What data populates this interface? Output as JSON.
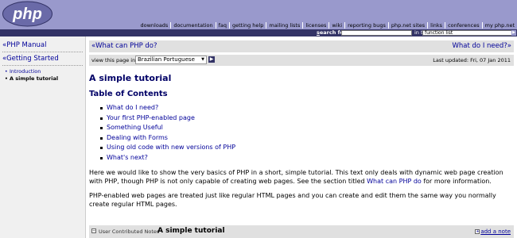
{
  "header": {
    "logo_text": "php",
    "nav": [
      "downloads",
      "documentation",
      "faq",
      "getting help",
      "mailing lists",
      "licenses",
      "wiki",
      "reporting bugs",
      "php.net sites",
      "links",
      "conferences",
      "my php.net"
    ],
    "search_label_underlined": "s",
    "search_label_rest": "earch for",
    "search_in": "in the",
    "search_scope": "function list"
  },
  "sidebar": {
    "manual_link": "PHP Manual",
    "section_title": "Getting Started",
    "items": [
      {
        "label": "Introduction",
        "active": false
      },
      {
        "label": "A simple tutorial",
        "active": true
      }
    ]
  },
  "main": {
    "prev_label": "What can PHP do?",
    "next_label": "What do I need?",
    "lang_label": "view this page in",
    "lang_value": "Brazilian Portuguese",
    "last_updated": "Last updated: Fri, 07 Jan 2011",
    "title": "A simple tutorial",
    "toc_title": "Table of Contents",
    "toc": [
      "What do I need?",
      "Your first PHP-enabled page",
      "Something Useful",
      "Dealing with Forms",
      "Using old code with new versions of PHP",
      "What's next?"
    ],
    "para1_a": "Here we would like to show the very basics of PHP in a short, simple tutorial. This text only deals with dynamic web page creation with PHP, though PHP is not only capable of creating web pages. See the section titled ",
    "para1_link": "What can PHP do",
    "para1_b": " for more information.",
    "para2": "PHP-enabled web pages are treated just like regular HTML pages and you can create and edit them the same way you normally create regular HTML pages."
  },
  "notes": {
    "label": "User Contributed Notes",
    "title": "A simple tutorial",
    "add": "add a note"
  }
}
